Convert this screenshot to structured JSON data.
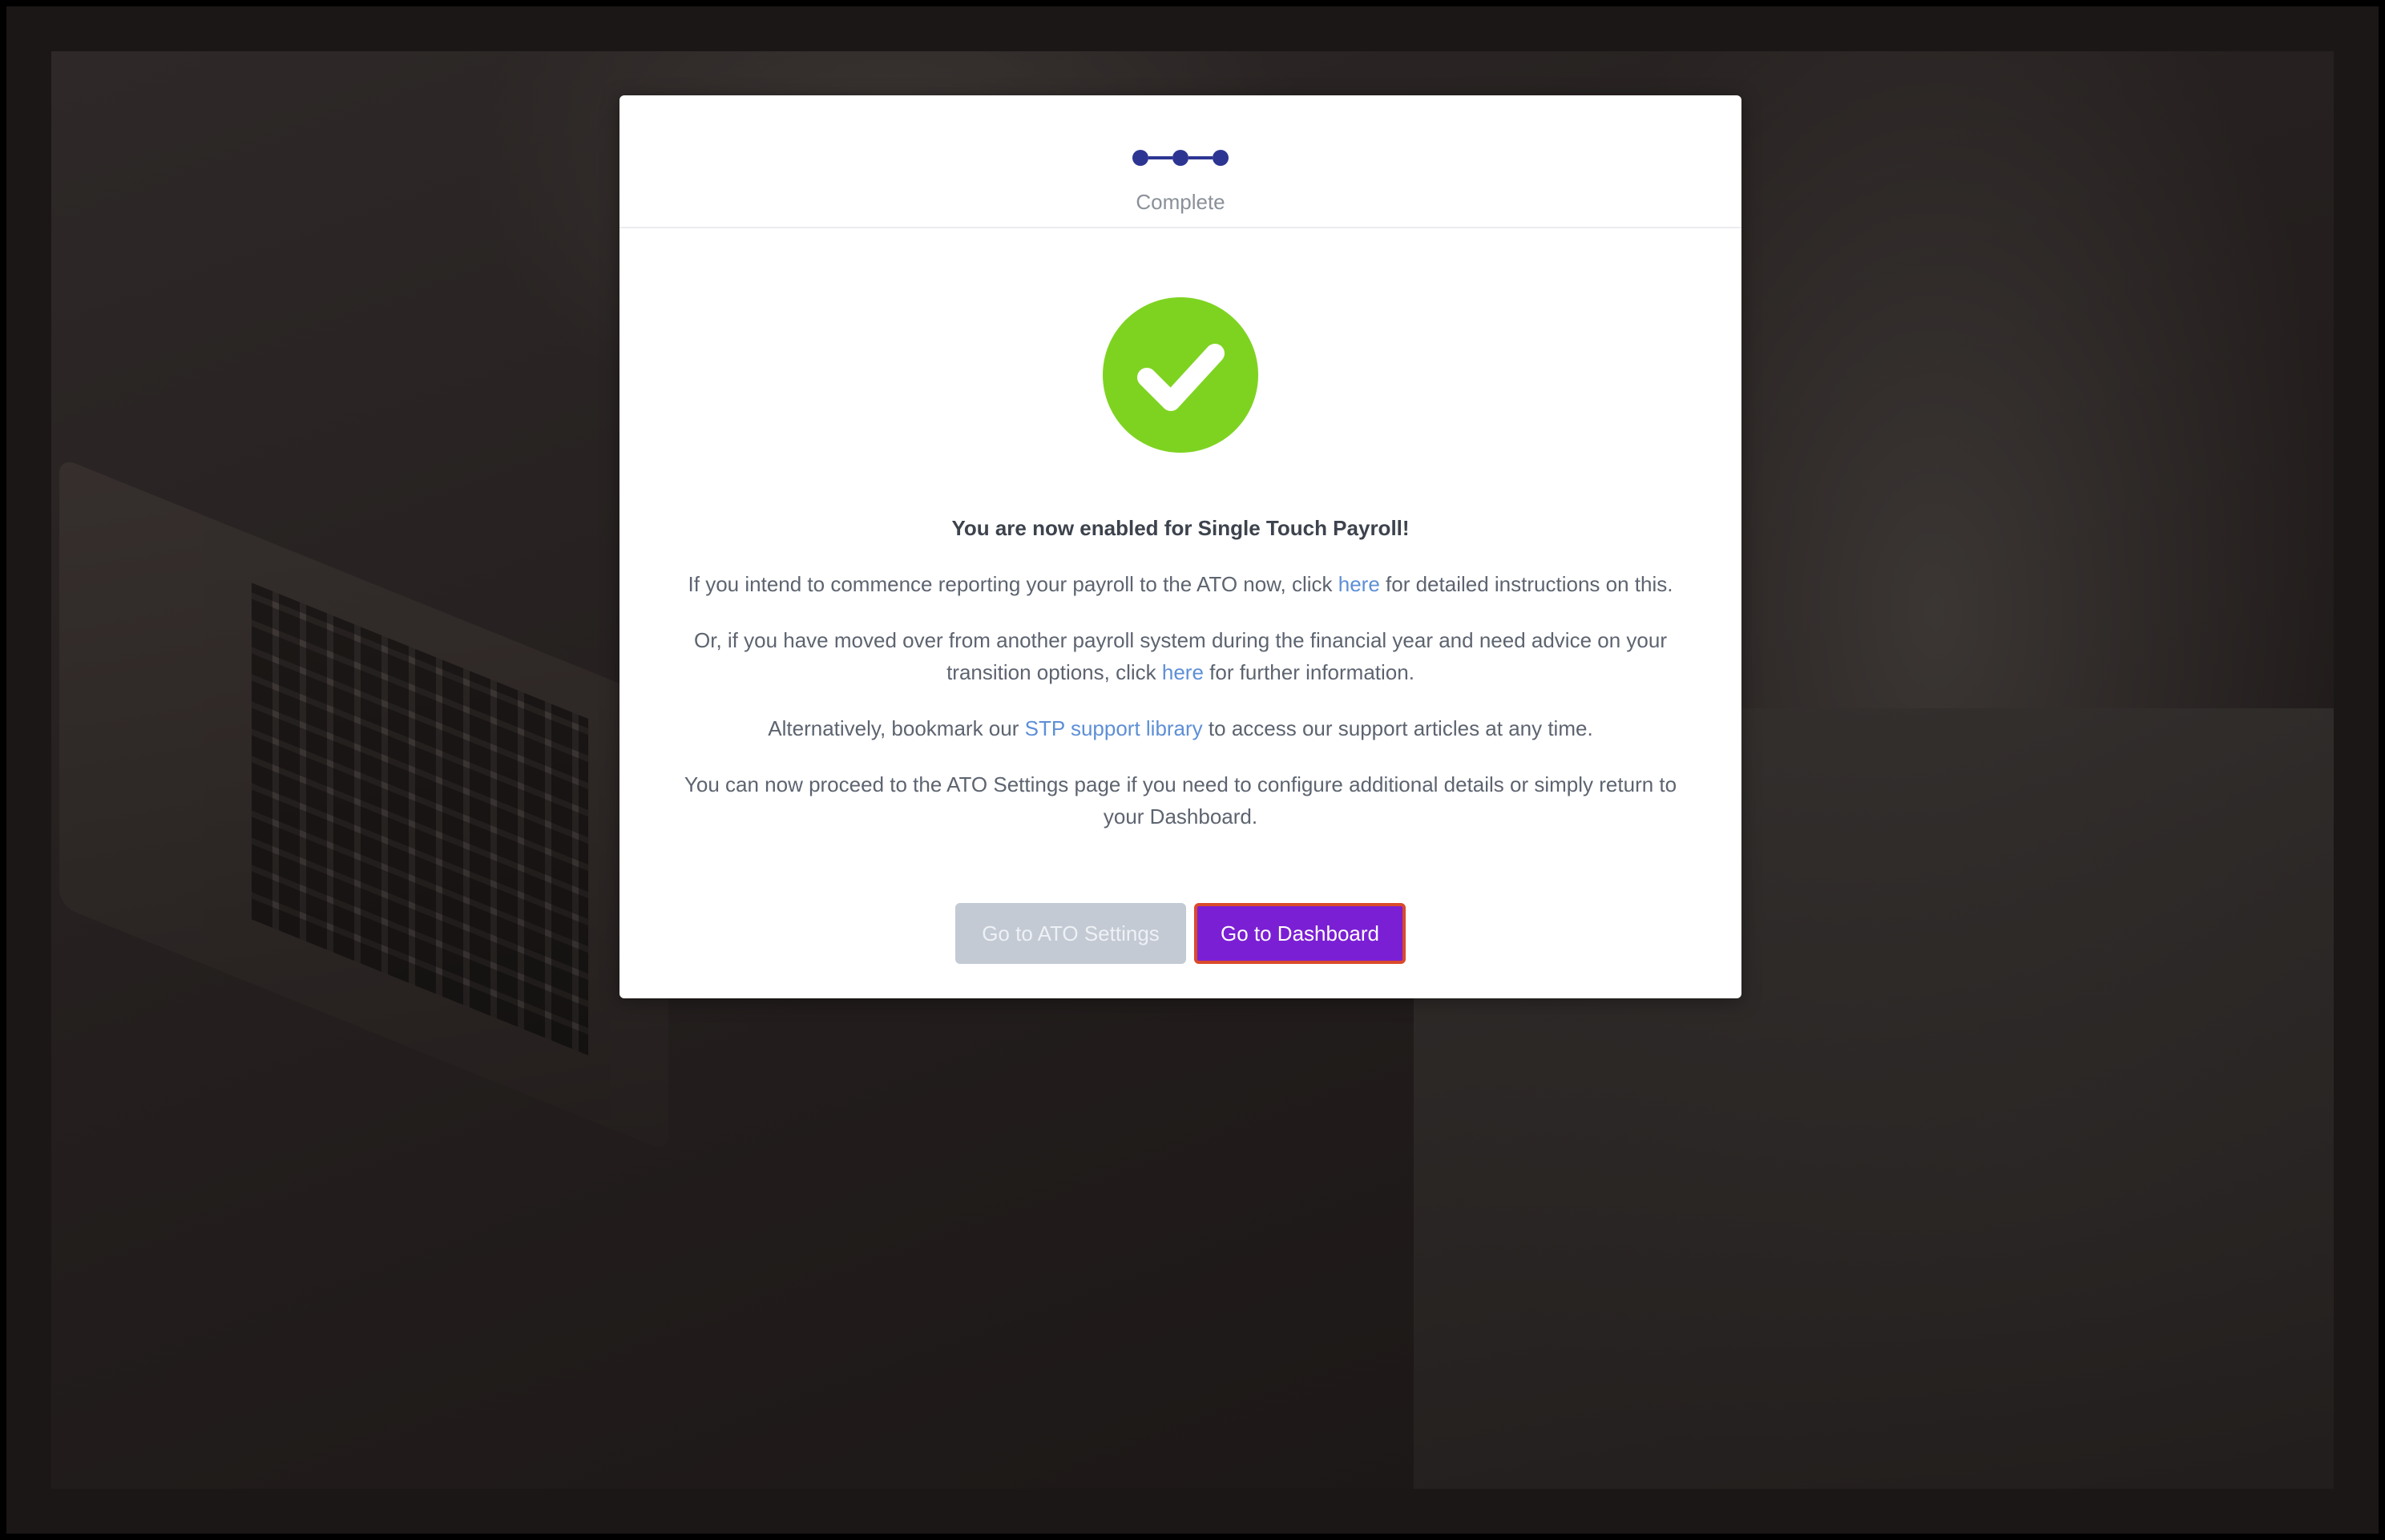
{
  "stepper": {
    "steps": 3,
    "label": "Complete",
    "color": "#2d3592"
  },
  "success_icon": {
    "name": "check-icon",
    "color": "#7ed321"
  },
  "message": {
    "headline": "You are now enabled for Single Touch Payroll!",
    "p1_before": "If you intend to commence reporting your payroll to the ATO now, click ",
    "p1_link": "here",
    "p1_after": " for detailed instructions on this.",
    "p2_before": "Or, if you have moved over from another payroll system during the financial year and need advice on your transition options, click ",
    "p2_link": "here",
    "p2_after": " for further information.",
    "p3_before": "Alternatively, bookmark our ",
    "p3_link": "STP support library",
    "p3_after": " to access our support articles at any time.",
    "p4": "You can now proceed to the ATO Settings page if you need to configure additional details or simply return to your Dashboard."
  },
  "buttons": {
    "ato_settings": "Go to ATO Settings",
    "dashboard": "Go to Dashboard"
  },
  "colors": {
    "link": "#5e8fd6",
    "primary_button": "#7b1fd4",
    "secondary_button": "#c3cad4"
  }
}
